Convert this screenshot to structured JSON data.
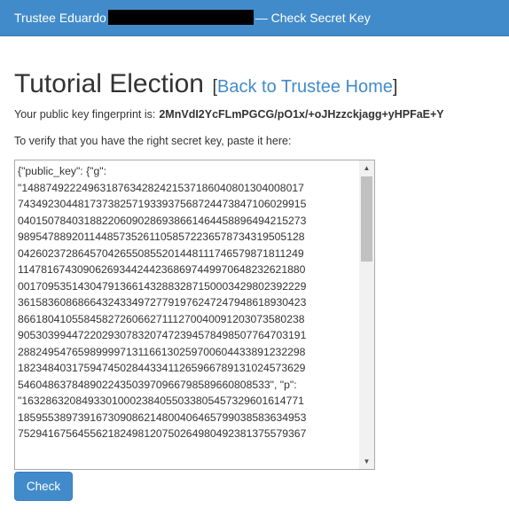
{
  "header": {
    "prefix": "Trustee Eduardo",
    "suffix": "— Check Secret Key"
  },
  "page": {
    "title": "Tutorial Election",
    "bracket_open": "[",
    "back_link": "Back to Trustee Home",
    "bracket_close": "]"
  },
  "fingerprint": {
    "label": "Your public key fingerprint is:",
    "value": "2MnVdI2YcFLmPGCG/pO1x/+oJHzzckjagg+yHPFaE+Y"
  },
  "instruction": "To verify that you have the right secret key, paste it here:",
  "secret_key": {
    "lines": [
      "{\"public_key\": {\"g\":",
      "\"148874922249631876342824215371860408013040080 17",
      "7434923044817373825719339375687244738471060299 15",
      "0401507840318822060902869386614644588964942152 73",
      "9895478892011448573526110585722365787343195051 28",
      "0426023728645704265508552014481117465798718112 49",
      "1147816743090626934424423686974499706482326218 80",
      "0017095351430479136614328832871500034298023922 29",
      "3615836086866432433497277919762472479486189304 23",
      "8661804105584582726066271112700400912030735802 38",
      "9053039944722029307832074723945784985077647031 91",
      "2882495476598999971311661302597006044338912322 98",
      "1823484031759474502844334112659667891310245736 29",
      "5460486378489022435039709667985896608085 33\", \"p\":",
      "\"163286320849330100023840550338054573296016147 71",
      "1859553897391673090862148004064657990385836349 53",
      "7529416756455621824981207502649804923813755793 67"
    ]
  },
  "check_button": "Check"
}
